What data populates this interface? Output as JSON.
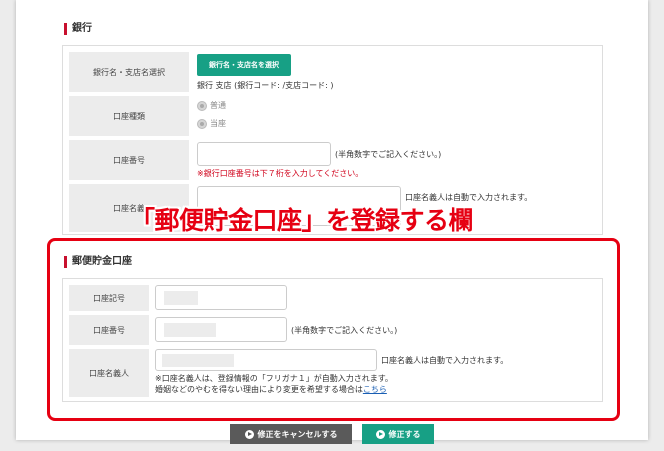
{
  "bank_section": {
    "title": "銀行",
    "rows": {
      "bank_select": {
        "label": "銀行名・支店名選択",
        "button": "銀行名・支店名を選択",
        "info": "銀行 支店 (銀行コード: /支店コード: )"
      },
      "account_type": {
        "label": "口座種類",
        "options": [
          "普通",
          "当座"
        ]
      },
      "account_number": {
        "label": "口座番号",
        "hint": "(半角数字でご記入ください。)",
        "warning": "※銀行口座番号は下７桁を入力してください。"
      },
      "account_holder": {
        "label": "口座名義",
        "auto_note": "口座名義人は自動で入力されます。"
      }
    }
  },
  "callout": "「郵便貯金口座」を登録する欄",
  "postal_section": {
    "title": "郵便貯金口座",
    "rows": {
      "account_symbol": {
        "label": "口座記号"
      },
      "account_number": {
        "label": "口座番号",
        "hint": "(半角数字でご記入ください。)"
      },
      "account_holder": {
        "label": "口座名義人",
        "auto_note": "口座名義人は自動で入力されます。",
        "note1": "※口座名義人は、登録情報の「フリガナ１」が自動入力されます。",
        "note2_prefix": "婚姻などのやむを得ない理由により変更を希望する場合は",
        "note2_link": "こちら"
      }
    }
  },
  "buttons": {
    "cancel": "修正をキャンセルする",
    "submit": "修正する"
  },
  "colors": {
    "accent_green": "#17a085",
    "highlight_red": "#e60012",
    "section_marker": "#c8102e"
  }
}
